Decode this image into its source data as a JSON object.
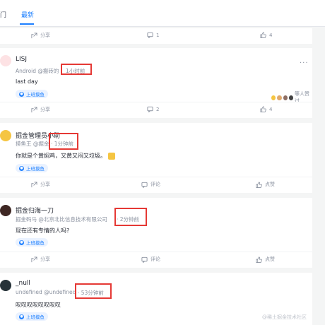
{
  "tabs": [
    {
      "label": "门"
    },
    {
      "label": "最新"
    }
  ],
  "actions_labels": {
    "share": "分享",
    "comment": "评论",
    "like": "点赞"
  },
  "posts": [
    {
      "share": "分享",
      "comments": "1",
      "likes": "4"
    },
    {
      "name": "LISJ",
      "meta": "Android @搬砖的",
      "time": "1小时前",
      "content": "last day",
      "topic": "上班摸鱼",
      "liked_text": "等人赞过",
      "share": "分享",
      "comments": "2",
      "likes": "4"
    },
    {
      "name": "掘金管理员小助",
      "meta": "摸鱼王 @掘金",
      "time": "· 1分钟前",
      "content": "你就是个黄焖鸡，又黄又闷又垃圾。",
      "topic": "上班摸鱼",
      "share": "分享",
      "comments": "评论",
      "likes": "点赞"
    },
    {
      "name": "掘金归海一刀",
      "meta": "掘金码马 @北京北比信息技术有限公司",
      "time": "· 2分钟前",
      "content": "现在还有专情的人吗?",
      "topic": "上班摸鱼",
      "share": "分享",
      "comments": "评论",
      "likes": "点赞"
    },
    {
      "name": "_null",
      "meta": "undefined @undefined",
      "time": "· 53分钟前",
      "content": "叹叹叹叹叹叹叹叹",
      "topic": "上班摸鱼"
    }
  ],
  "watermark": "@稀土掘金技术社区",
  "colors": {
    "accent": "#1e80ff",
    "highlight_box": "#e53935",
    "muted": "#8a919f"
  }
}
